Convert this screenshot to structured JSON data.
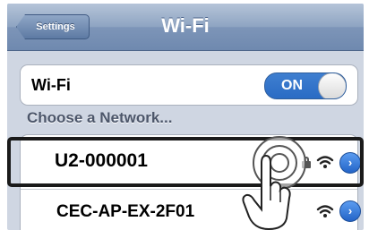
{
  "navbar": {
    "back_label": "Settings",
    "title": "Wi-Fi"
  },
  "wifi_toggle": {
    "label": "Wi-Fi",
    "state": "ON"
  },
  "section_header": "Choose a Network...",
  "networks": [
    {
      "name": "U2-000001",
      "secured": true,
      "selected": true
    },
    {
      "name": "CEC-AP-EX-2F01",
      "secured": false,
      "selected": false
    }
  ],
  "icons": {
    "lock": "lock-icon",
    "wifi": "wifi-signal-icon",
    "disclosure": "chevron-right-icon",
    "touch": "tap-gesture-icon"
  },
  "colors": {
    "nav": "#7d95b8",
    "toggle_on": "#2a6bc4",
    "disclosure": "#2364c7"
  }
}
